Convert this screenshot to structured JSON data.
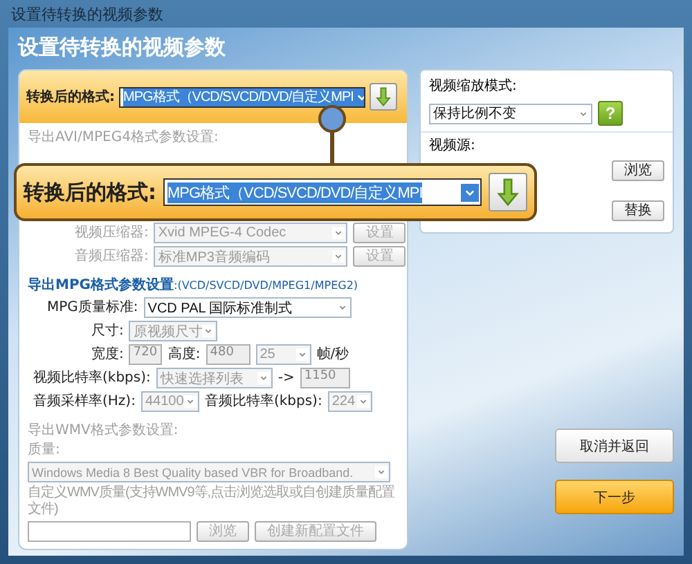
{
  "window": {
    "title": "设置待转换的视频参数"
  },
  "heading": "设置待转换的视频参数",
  "format": {
    "label": "转换后的格式:",
    "value": "MPG格式（VCD/SVCD/DVD/自定义MPI"
  },
  "avi": {
    "title": "导出AVI/MPEG4格式参数设置:",
    "disabled": true,
    "rows": [
      {
        "label": "视频压缩器:",
        "value": "Xvid MPEG-4 Codec",
        "button": "设置"
      },
      {
        "label": "音频压缩器:",
        "value": "标准MP3音频编码",
        "button": "设置"
      }
    ]
  },
  "mpg": {
    "title": "导出MPG格式参数设置",
    "subtitle": ":(VCD/SVCD/DVD/MPEG1/MPEG2)",
    "disabled": false,
    "quality": {
      "label": "MPG质量标准:",
      "value": "VCD  PAL 国际标准制式"
    },
    "size": {
      "label": "尺寸:",
      "value": "原视频尺寸"
    },
    "width": {
      "label": "宽度:",
      "value": "720"
    },
    "height": {
      "label": "高度:",
      "value": "480"
    },
    "fps": {
      "value": "25",
      "unit": "帧/秒"
    },
    "video_bitrate": {
      "label": "视频比特率(kbps):",
      "value": "快速选择列表",
      "arrow": "->",
      "custom": "1150"
    },
    "audio_rate": {
      "label": "音频采样率(Hz):",
      "value": "44100"
    },
    "audio_bitrate": {
      "label": "音频比特率(kbps):",
      "value": "224"
    }
  },
  "wmv": {
    "title": "导出WMV格式参数设置:",
    "disabled": true,
    "quality_label": "质量:",
    "quality_value": "Windows Media 8 Best Quality based VBR for Broadband.",
    "custom_label": "自定义WMV质量(支持WMV9等,点击浏览选取或自创建质量配置文件)",
    "browse": "浏览",
    "create": "创建新配置文件"
  },
  "scale": {
    "label": "视频缩放模式:",
    "value": "保持比例不变",
    "help": "?"
  },
  "source": {
    "label": "视频源:",
    "browse": "浏览"
  },
  "output": {
    "replace": "替换"
  },
  "callout": {
    "label": "转换后的格式:",
    "value": "MPG格式（VCD/SVCD/DVD/自定义MPI"
  },
  "buttons": [
    {
      "label": "取消并返回",
      "kind": "secondary"
    },
    {
      "label": "下一步",
      "kind": "primary"
    }
  ]
}
